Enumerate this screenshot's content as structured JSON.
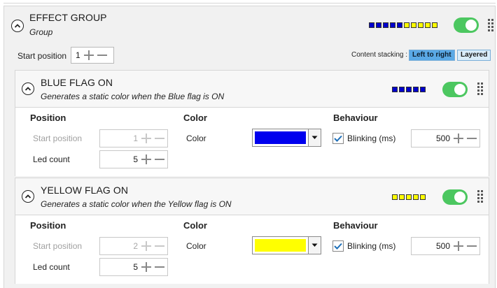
{
  "effect_group": {
    "title": "EFFECT GROUP",
    "subtitle": "Group",
    "enabled": true,
    "led_colors": [
      "#0000cc",
      "#0000cc",
      "#0000cc",
      "#0000cc",
      "#0000cc",
      "#ffff00",
      "#ffff00",
      "#ffff00",
      "#ffff00",
      "#ffff00"
    ],
    "start_position_label": "Start position",
    "start_position_value": "1",
    "stacking_label": "Content stacking :",
    "stacking_options": [
      "Left to right",
      "Layered"
    ],
    "stacking_selected": "Left to right"
  },
  "effects": [
    {
      "title": "BLUE FLAG ON",
      "subtitle": "Generates a static color when the Blue flag is ON",
      "enabled": true,
      "led_colors": [
        "#0000cc",
        "#0000cc",
        "#0000cc",
        "#0000cc",
        "#0000cc"
      ],
      "position_header": "Position",
      "color_header": "Color",
      "behaviour_header": "Behaviour",
      "start_position_label": "Start position",
      "start_position_value": "1",
      "led_count_label": "Led count",
      "led_count_value": "5",
      "color_label": "Color",
      "color_value": "#0000ee",
      "blinking_label": "Blinking (ms)",
      "blinking_checked": true,
      "blinking_value": "500"
    },
    {
      "title": "YELLOW FLAG ON",
      "subtitle": "Generates a static color when the Yellow flag is ON",
      "enabled": true,
      "led_colors": [
        "#ffff00",
        "#ffff00",
        "#ffff00",
        "#ffff00",
        "#ffff00"
      ],
      "position_header": "Position",
      "color_header": "Color",
      "behaviour_header": "Behaviour",
      "start_position_label": "Start position",
      "start_position_value": "2",
      "led_count_label": "Led count",
      "led_count_value": "5",
      "color_label": "Color",
      "color_value": "#ffff00",
      "blinking_label": "Blinking (ms)",
      "blinking_checked": true,
      "blinking_value": "500"
    }
  ],
  "colors": {
    "toggle_on": "#4cc760",
    "stacking_active_bg": "#5aa9e6",
    "stacking_inactive_bg": "#d9ecfa",
    "check_mark": "#1e6fb8"
  }
}
